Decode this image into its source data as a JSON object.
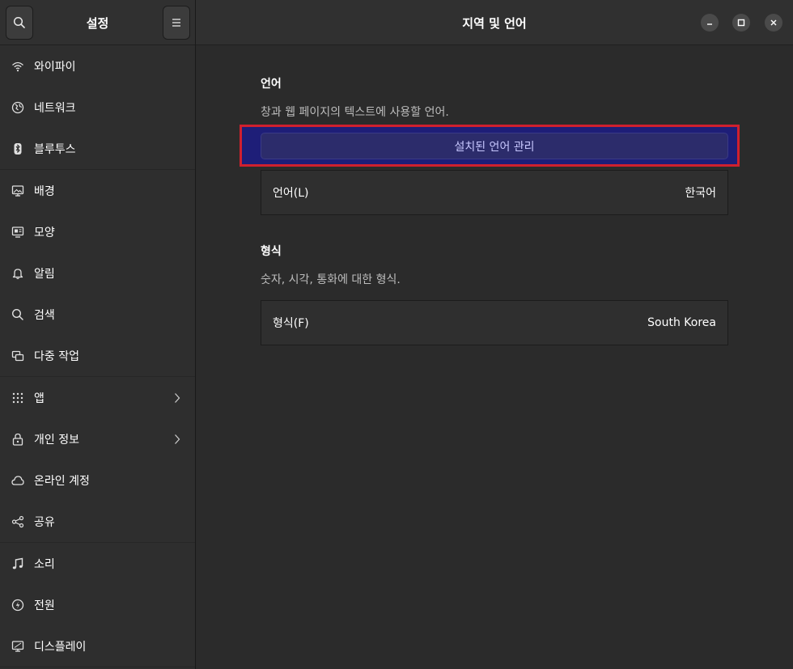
{
  "sidebar": {
    "title": "설정",
    "groups": [
      [
        {
          "label": "와이파이",
          "icon": "wifi-icon"
        },
        {
          "label": "네트워크",
          "icon": "network-icon"
        },
        {
          "label": "블루투스",
          "icon": "bluetooth-icon"
        }
      ],
      [
        {
          "label": "배경",
          "icon": "background-icon"
        },
        {
          "label": "모양",
          "icon": "appearance-icon"
        },
        {
          "label": "알림",
          "icon": "bell-icon"
        },
        {
          "label": "검색",
          "icon": "search-icon"
        },
        {
          "label": "다중 작업",
          "icon": "multitasking-icon"
        }
      ],
      [
        {
          "label": "앱",
          "icon": "apps-grid-icon",
          "chevron": true
        },
        {
          "label": "개인 정보",
          "icon": "lock-icon",
          "chevron": true
        },
        {
          "label": "온라인 계정",
          "icon": "cloud-icon"
        },
        {
          "label": "공유",
          "icon": "share-icon"
        }
      ],
      [
        {
          "label": "소리",
          "icon": "music-note-icon"
        },
        {
          "label": "전원",
          "icon": "power-icon"
        },
        {
          "label": "디스플레이",
          "icon": "display-icon"
        }
      ]
    ]
  },
  "header": {
    "title": "지역 및 언어"
  },
  "language_section": {
    "title": "언어",
    "description": "창과 웹 페이지의 텍스트에 사용할 언어.",
    "manage_button": "설치된 언어 관리",
    "row_label": "언어(L)",
    "row_value": "한국어"
  },
  "format_section": {
    "title": "형식",
    "description": "숫자, 시각, 통화에 대한 형식.",
    "row_label": "형식(F)",
    "row_value": "South Korea"
  },
  "colors": {
    "accent_button": "#2c2c6b",
    "highlight_border": "#d0202e"
  }
}
